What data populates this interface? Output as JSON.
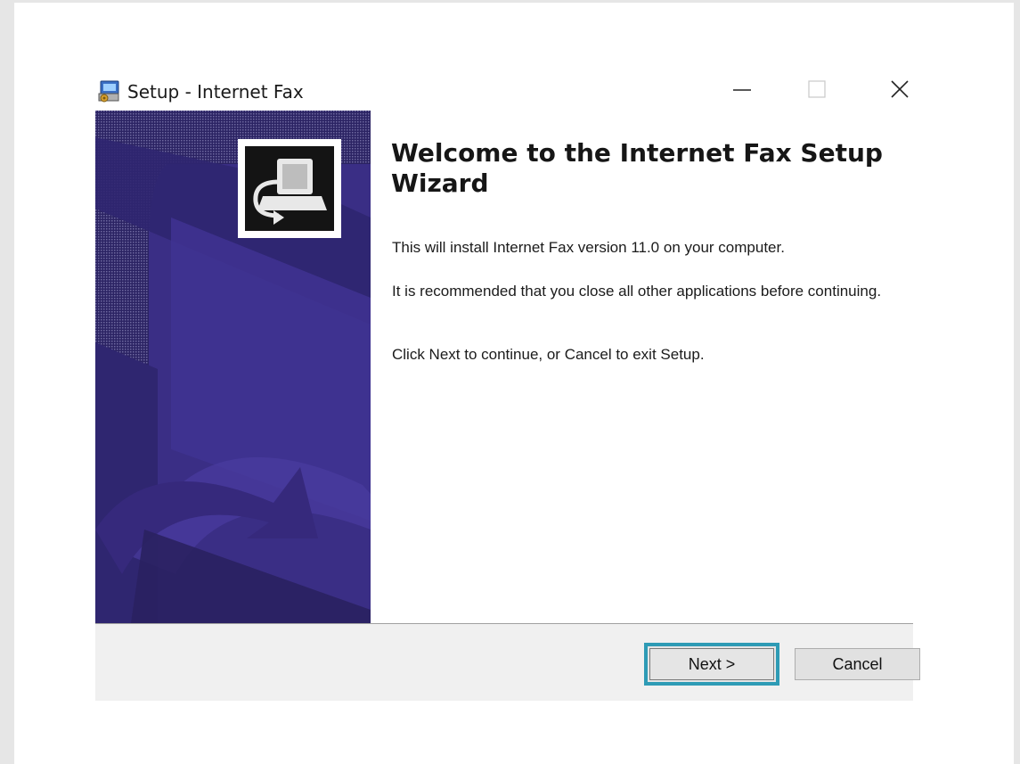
{
  "window": {
    "title": "Setup - Internet Fax"
  },
  "icons": {
    "app": "setup-installer-icon",
    "minimize": "minimize-icon",
    "maximize": "maximize-icon",
    "close": "close-icon",
    "wizard_logo": "fax-machine-icon"
  },
  "content": {
    "heading": "Welcome to the Internet Fax Setup Wizard",
    "paragraph1": "This will install Internet Fax version 11.0 on your computer.",
    "paragraph2": "It is recommended that you close all other applications before continuing.",
    "paragraph3": "Click Next to continue, or Cancel to exit Setup."
  },
  "buttons": {
    "next_label": "Next >",
    "cancel_label": "Cancel"
  },
  "colors": {
    "sidebar_bg": "#2d2466",
    "sidebar_shape": "#3b2f82",
    "focus_ring": "#2e9bb5"
  }
}
